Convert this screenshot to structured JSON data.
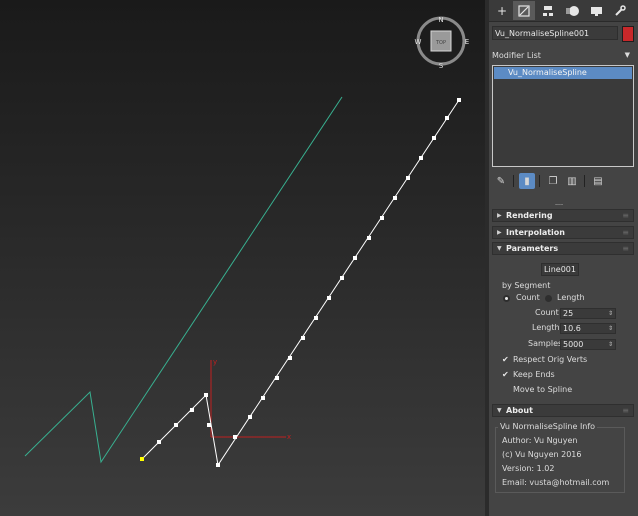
{
  "viewport": {
    "compass": {
      "north": "N",
      "south": "S",
      "east": "E",
      "west": "W",
      "cube_label": "TOP"
    },
    "gizmo": {
      "x_label": "x",
      "y_label": "y"
    },
    "colors": {
      "original_spline": "#38b090",
      "resampled_spline": "#ffffff",
      "first_vertex": "#ffff00",
      "gizmo": "#c02020"
    }
  },
  "panel": {
    "tab_icons": [
      "plus-icon",
      "modify-icon",
      "hierarchy-icon",
      "motion-icon",
      "display-icon",
      "utilities-icon"
    ],
    "object_name": "Vu_NormaliseSpline001",
    "object_color": "#c8282a",
    "modifier_list_label": "Modifier List",
    "stack_item": "Vu_NormaliseSpline",
    "rollouts": {
      "rendering": "Rendering",
      "interpolation": "Interpolation",
      "parameters": "Parameters",
      "about": "About"
    },
    "parameters": {
      "pick_button": "Line001",
      "by_segment": "by Segment",
      "mode_count": "Count",
      "mode_length": "Length",
      "count_label": "Count",
      "count_value": "25",
      "length_label": "Length",
      "length_value": "10.6",
      "samples_label": "Samples",
      "samples_value": "5000",
      "respect_orig_verts": "Respect Orig Verts",
      "keep_ends": "Keep Ends",
      "move_to_spline": "Move to Spline"
    },
    "about": {
      "group_title": "Vu NormaliseSpline Info",
      "author": "Author: Vu Nguyen",
      "copyright": "(c) Vu Nguyen 2016",
      "version": "Version: 1.02",
      "email": "Email: vusta@hotmail.com"
    }
  }
}
